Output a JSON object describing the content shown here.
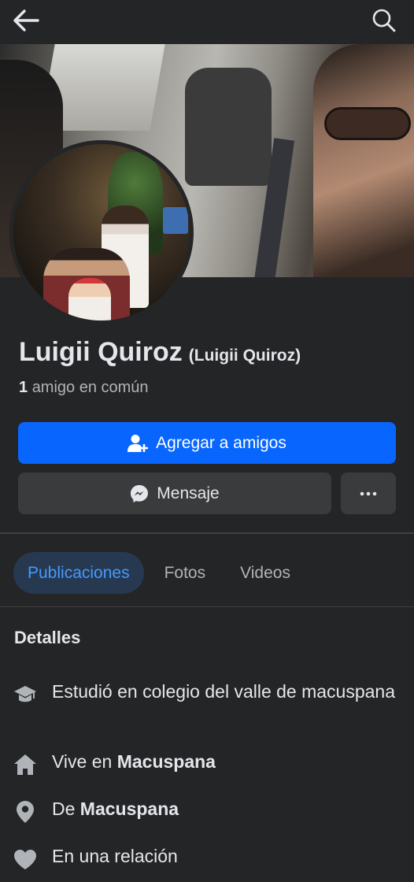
{
  "header": {
    "back_icon": "arrow-left-icon",
    "search_icon": "search-icon"
  },
  "profile": {
    "name": "Luigii Quiroz",
    "alternate_name": "(Luigii Quiroz)",
    "mutual_count": "1",
    "mutual_text": "amigo en común"
  },
  "actions": {
    "add_friend_label": "Agregar a amigos",
    "add_friend_icon": "person-add-icon",
    "message_label": "Mensaje",
    "message_icon": "messenger-icon",
    "more_label": "···",
    "accent_color": "#0866ff"
  },
  "tabs": [
    {
      "label": "Publicaciones",
      "active": true
    },
    {
      "label": "Fotos",
      "active": false
    },
    {
      "label": "Videos",
      "active": false
    }
  ],
  "details": {
    "title": "Detalles",
    "items": [
      {
        "icon": "graduation-cap-icon",
        "prefix": "Estudió en colegio del valle de macuspana",
        "bold": ""
      },
      {
        "icon": "home-icon",
        "prefix": "Vive en ",
        "bold": "Macuspana"
      },
      {
        "icon": "location-pin-icon",
        "prefix": "De ",
        "bold": "Macuspana"
      },
      {
        "icon": "heart-icon",
        "prefix": "En una relación",
        "bold": ""
      }
    ]
  }
}
